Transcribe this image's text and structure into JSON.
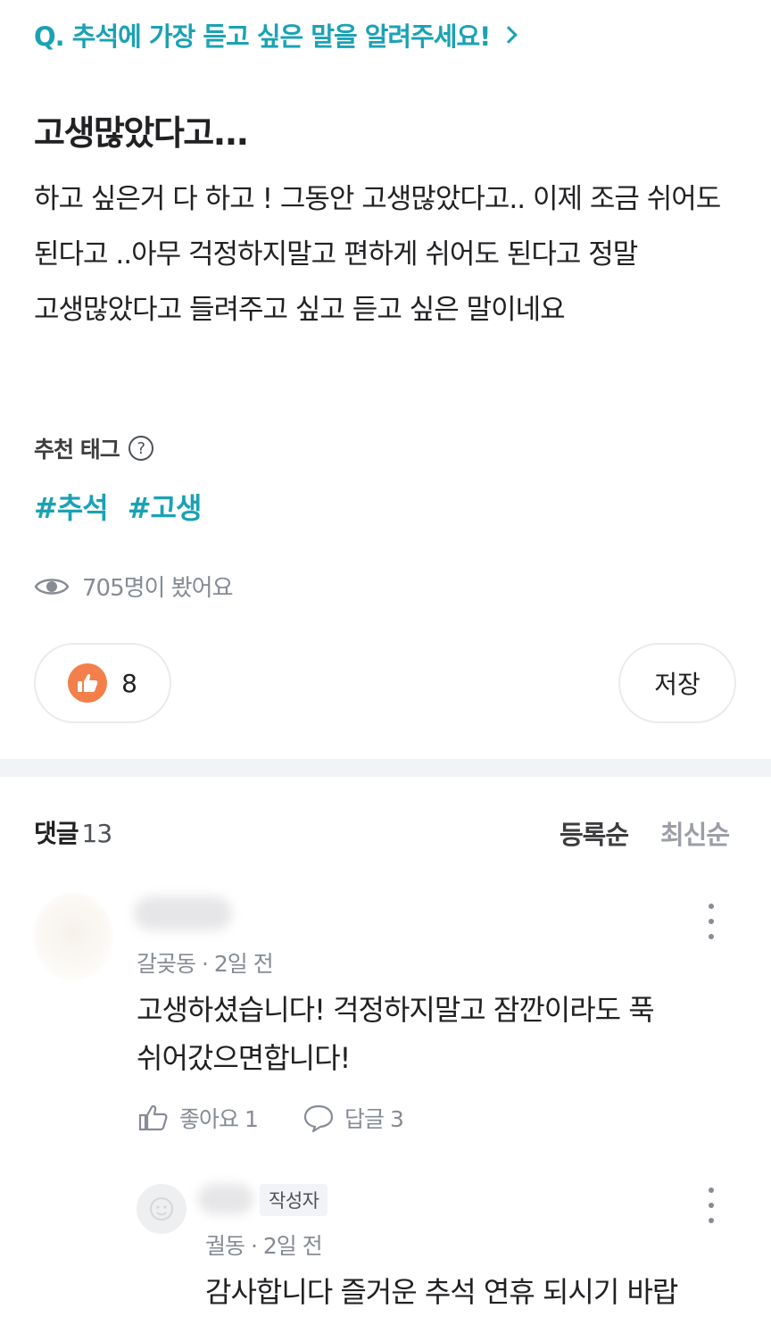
{
  "question": {
    "text": "Q. 추석에 가장 듣고 싶은 말을 알려주세요!"
  },
  "post": {
    "title": "고생많았다고...",
    "body": "하고 싶은거 다 하고 ! 그동안 고생많았다고.. 이제 조금 쉬어도 된다고 ..아무 걱정하지말고 편하게 쉬어도 된다고 정말 고생많았다고 들려주고 싶고 듣고 싶은 말이네요"
  },
  "tags_section": {
    "heading": "추천 태그",
    "help_glyph": "?",
    "items": [
      "#추석",
      "#고생"
    ]
  },
  "views": {
    "text": "705명이 봤어요"
  },
  "actions": {
    "like_count": "8",
    "save_label": "저장"
  },
  "comments": {
    "label": "댓글",
    "count": "13",
    "sort_registered": "등록순",
    "sort_newest": "최신순",
    "list": [
      {
        "meta": "갈곶동 · 2일 전",
        "text": "고생하셨습니다! 걱정하지말고 잠깐이라도 푹 쉬어갔으면합니다!",
        "like_label": "좋아요 1",
        "reply_label": "답글 3"
      }
    ],
    "reply": {
      "badge": "작성자",
      "meta": "궐동 · 2일 전",
      "text": "감사합니다 즐거운 추석 연휴 되시기 바랍"
    }
  },
  "colors": {
    "accent": "#1aa2b4",
    "like": "#f37f4a",
    "muted": "#868b94"
  }
}
